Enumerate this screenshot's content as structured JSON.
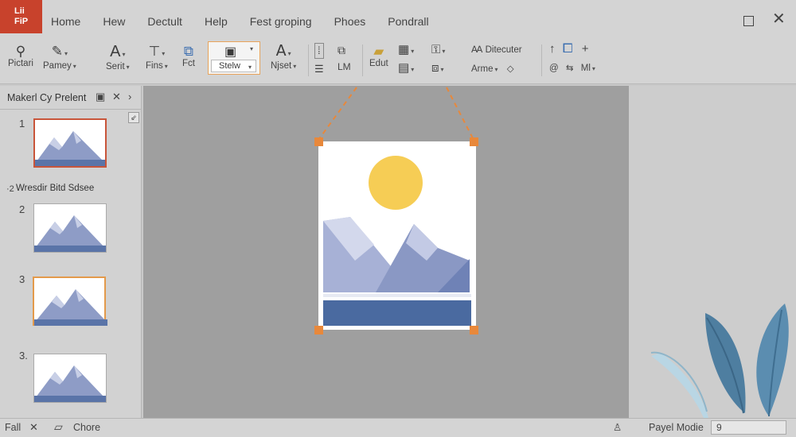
{
  "app_badge": {
    "line1": "Lii",
    "line2": "FiP"
  },
  "menu": [
    "Home",
    "Hew",
    "Dectult",
    "Help",
    "Fest groping",
    "Phoes",
    "Pondrall"
  ],
  "ribbon": {
    "pictari": "Pictari",
    "pamey": "Pamey",
    "serit": "Serit",
    "fins": "Fins",
    "fct": "Fct",
    "styles": "Stelw",
    "njset": "Njset",
    "lm": "LM",
    "edut": "Edut",
    "ditecuter": "Ditecuter",
    "arme": "Arme",
    "ml": "Ml"
  },
  "panel": {
    "title": "Makerl Cy Prelent",
    "section": "Wresdir Bitd Sdsee",
    "slide_numbers": [
      "1",
      "·2",
      "2",
      "3",
      "3."
    ]
  },
  "status": {
    "left": "Fall",
    "chore": "Chore",
    "mode": "Payel Modie",
    "zoom": "9"
  },
  "colors": {
    "accent": "#e8883b",
    "badge": "#c8422c",
    "mountain": "#7f8fbf",
    "sun": "#f6cd55",
    "water": "#4a6aa0",
    "leaf": "#4e7ea0"
  }
}
